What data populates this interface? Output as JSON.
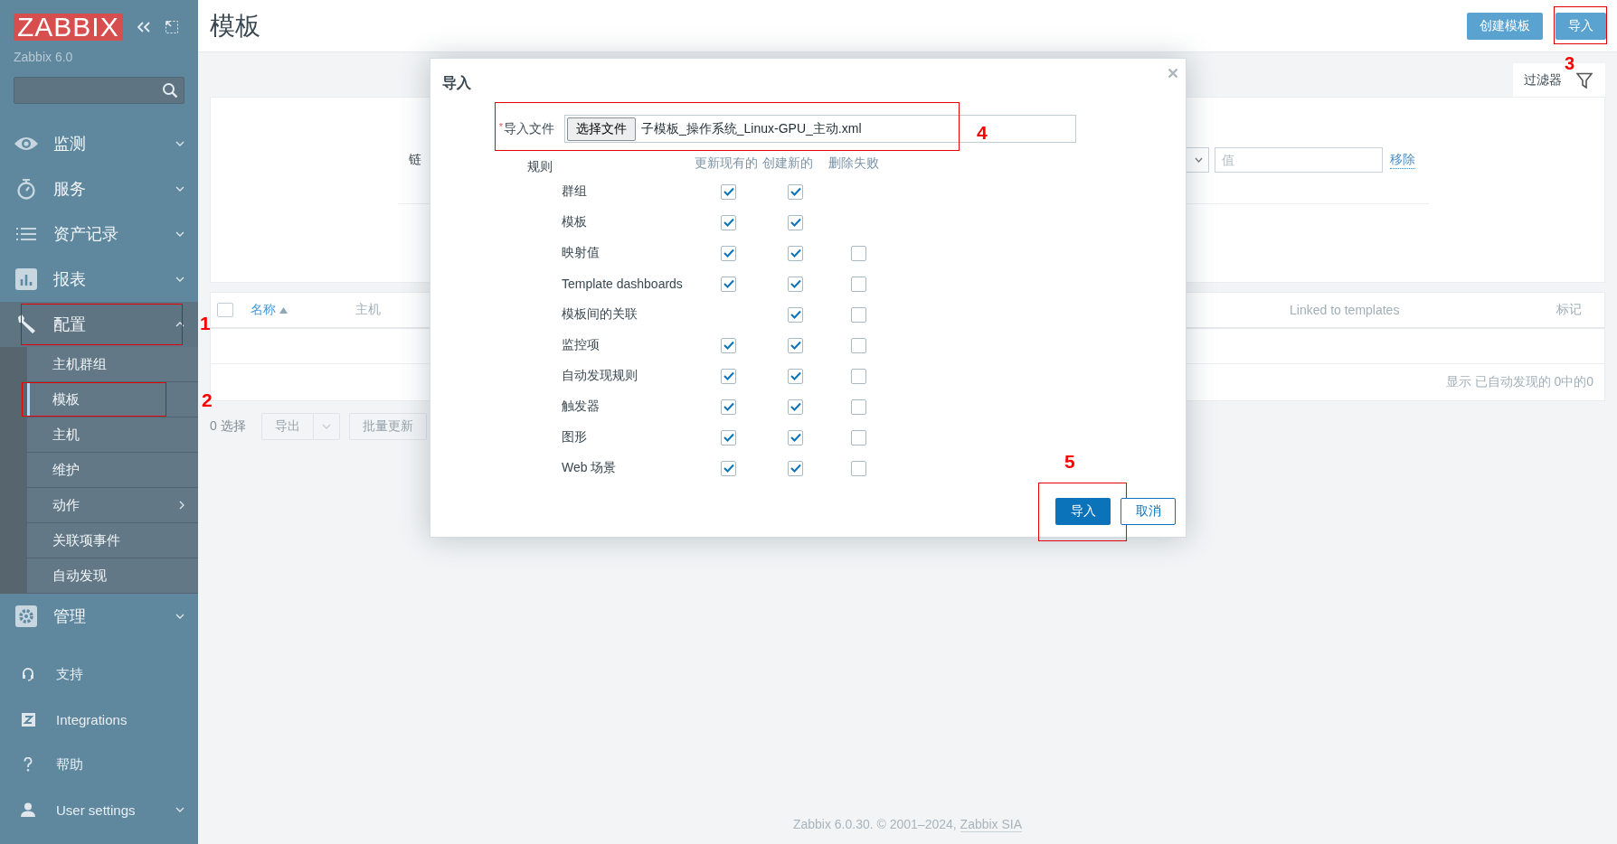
{
  "sidebar": {
    "logo": "ZABBIX",
    "version": "Zabbix 6.0",
    "menu": [
      {
        "label": "监测",
        "kind": "eye",
        "expanded": false,
        "selected": false
      },
      {
        "label": "服务",
        "kind": "timer",
        "expanded": false,
        "selected": false
      },
      {
        "label": "资产记录",
        "kind": "list",
        "expanded": false,
        "selected": false
      },
      {
        "label": "报表",
        "kind": "chart",
        "expanded": false,
        "selected": false
      },
      {
        "label": "配置",
        "kind": "wrench",
        "expanded": true,
        "selected": true,
        "annotation": "1",
        "children": [
          {
            "label": "主机群组",
            "selected": false
          },
          {
            "label": "模板",
            "selected": true,
            "annotation": "2"
          },
          {
            "label": "主机",
            "selected": false
          },
          {
            "label": "维护",
            "selected": false
          },
          {
            "label": "动作",
            "selected": false,
            "submenu": true
          },
          {
            "label": "关联项事件",
            "selected": false
          },
          {
            "label": "自动发现",
            "selected": false
          }
        ]
      },
      {
        "label": "管理",
        "kind": "gear",
        "expanded": false,
        "selected": false
      }
    ],
    "bottom_menu": [
      {
        "label": "支持",
        "kind": "headset",
        "expandable": false
      },
      {
        "label": "Integrations",
        "kind": "z",
        "expandable": false
      },
      {
        "label": "帮助",
        "kind": "help",
        "expandable": false
      },
      {
        "label": "User settings",
        "kind": "user",
        "expandable": true
      }
    ]
  },
  "header": {
    "title": "模板",
    "buttons": [
      {
        "label": "创建模板"
      },
      {
        "label": "导入",
        "annotation": "3"
      }
    ]
  },
  "filter": {
    "tab": "过滤器",
    "label": "链",
    "value_placeholder": "值",
    "remove_link": "移除"
  },
  "table": {
    "select_all": {
      "checked": false
    },
    "columns": [
      {
        "label": "名称",
        "sorted": true
      },
      {
        "label": "主机",
        "sorted": false
      },
      {
        "label": "Linked to templates",
        "sorted": false
      },
      {
        "label": "标记",
        "sorted": false
      }
    ],
    "footer": "显示 已自动发现的 0中的0"
  },
  "actions": {
    "selected_count": "0 选择",
    "buttons": [
      {
        "label": "导出",
        "dropdown": true,
        "disabled": true
      },
      {
        "label": "批量更新",
        "dropdown": false,
        "disabled": true
      }
    ]
  },
  "footer": {
    "text": "Zabbix 6.0.30. © 2001–2024, ",
    "link": "Zabbix SIA"
  },
  "modal": {
    "title": "导入",
    "file": {
      "label": "导入文件",
      "required_mark": "*",
      "button": "选择文件",
      "filename": "子模板_操作系统_Linux-GPU_主动.xml",
      "annotation": "4"
    },
    "rules_label": "规则",
    "rule_columns": [
      "更新现有的",
      "创建新的",
      "删除失败"
    ],
    "rules": [
      {
        "label": "群组",
        "update_existing": true,
        "create_new": true
      },
      {
        "label": "模板",
        "update_existing": true,
        "create_new": true
      },
      {
        "label": "映射值",
        "update_existing": true,
        "create_new": true,
        "delete_missing": false
      },
      {
        "label": "Template dashboards",
        "update_existing": true,
        "create_new": true,
        "delete_missing": false
      },
      {
        "label": "模板间的关联",
        "create_new": true,
        "delete_missing": false
      },
      {
        "label": "监控项",
        "update_existing": true,
        "create_new": true,
        "delete_missing": false
      },
      {
        "label": "自动发现规则",
        "update_existing": true,
        "create_new": true,
        "delete_missing": false
      },
      {
        "label": "触发器",
        "update_existing": true,
        "create_new": true,
        "delete_missing": false
      },
      {
        "label": "图形",
        "update_existing": true,
        "create_new": true,
        "delete_missing": false
      },
      {
        "label": "Web 场景",
        "update_existing": true,
        "create_new": true,
        "delete_missing": false
      }
    ],
    "buttons": [
      {
        "label": "导入",
        "primary": true,
        "annotation": "5"
      },
      {
        "label": "取消",
        "primary": false
      }
    ]
  }
}
